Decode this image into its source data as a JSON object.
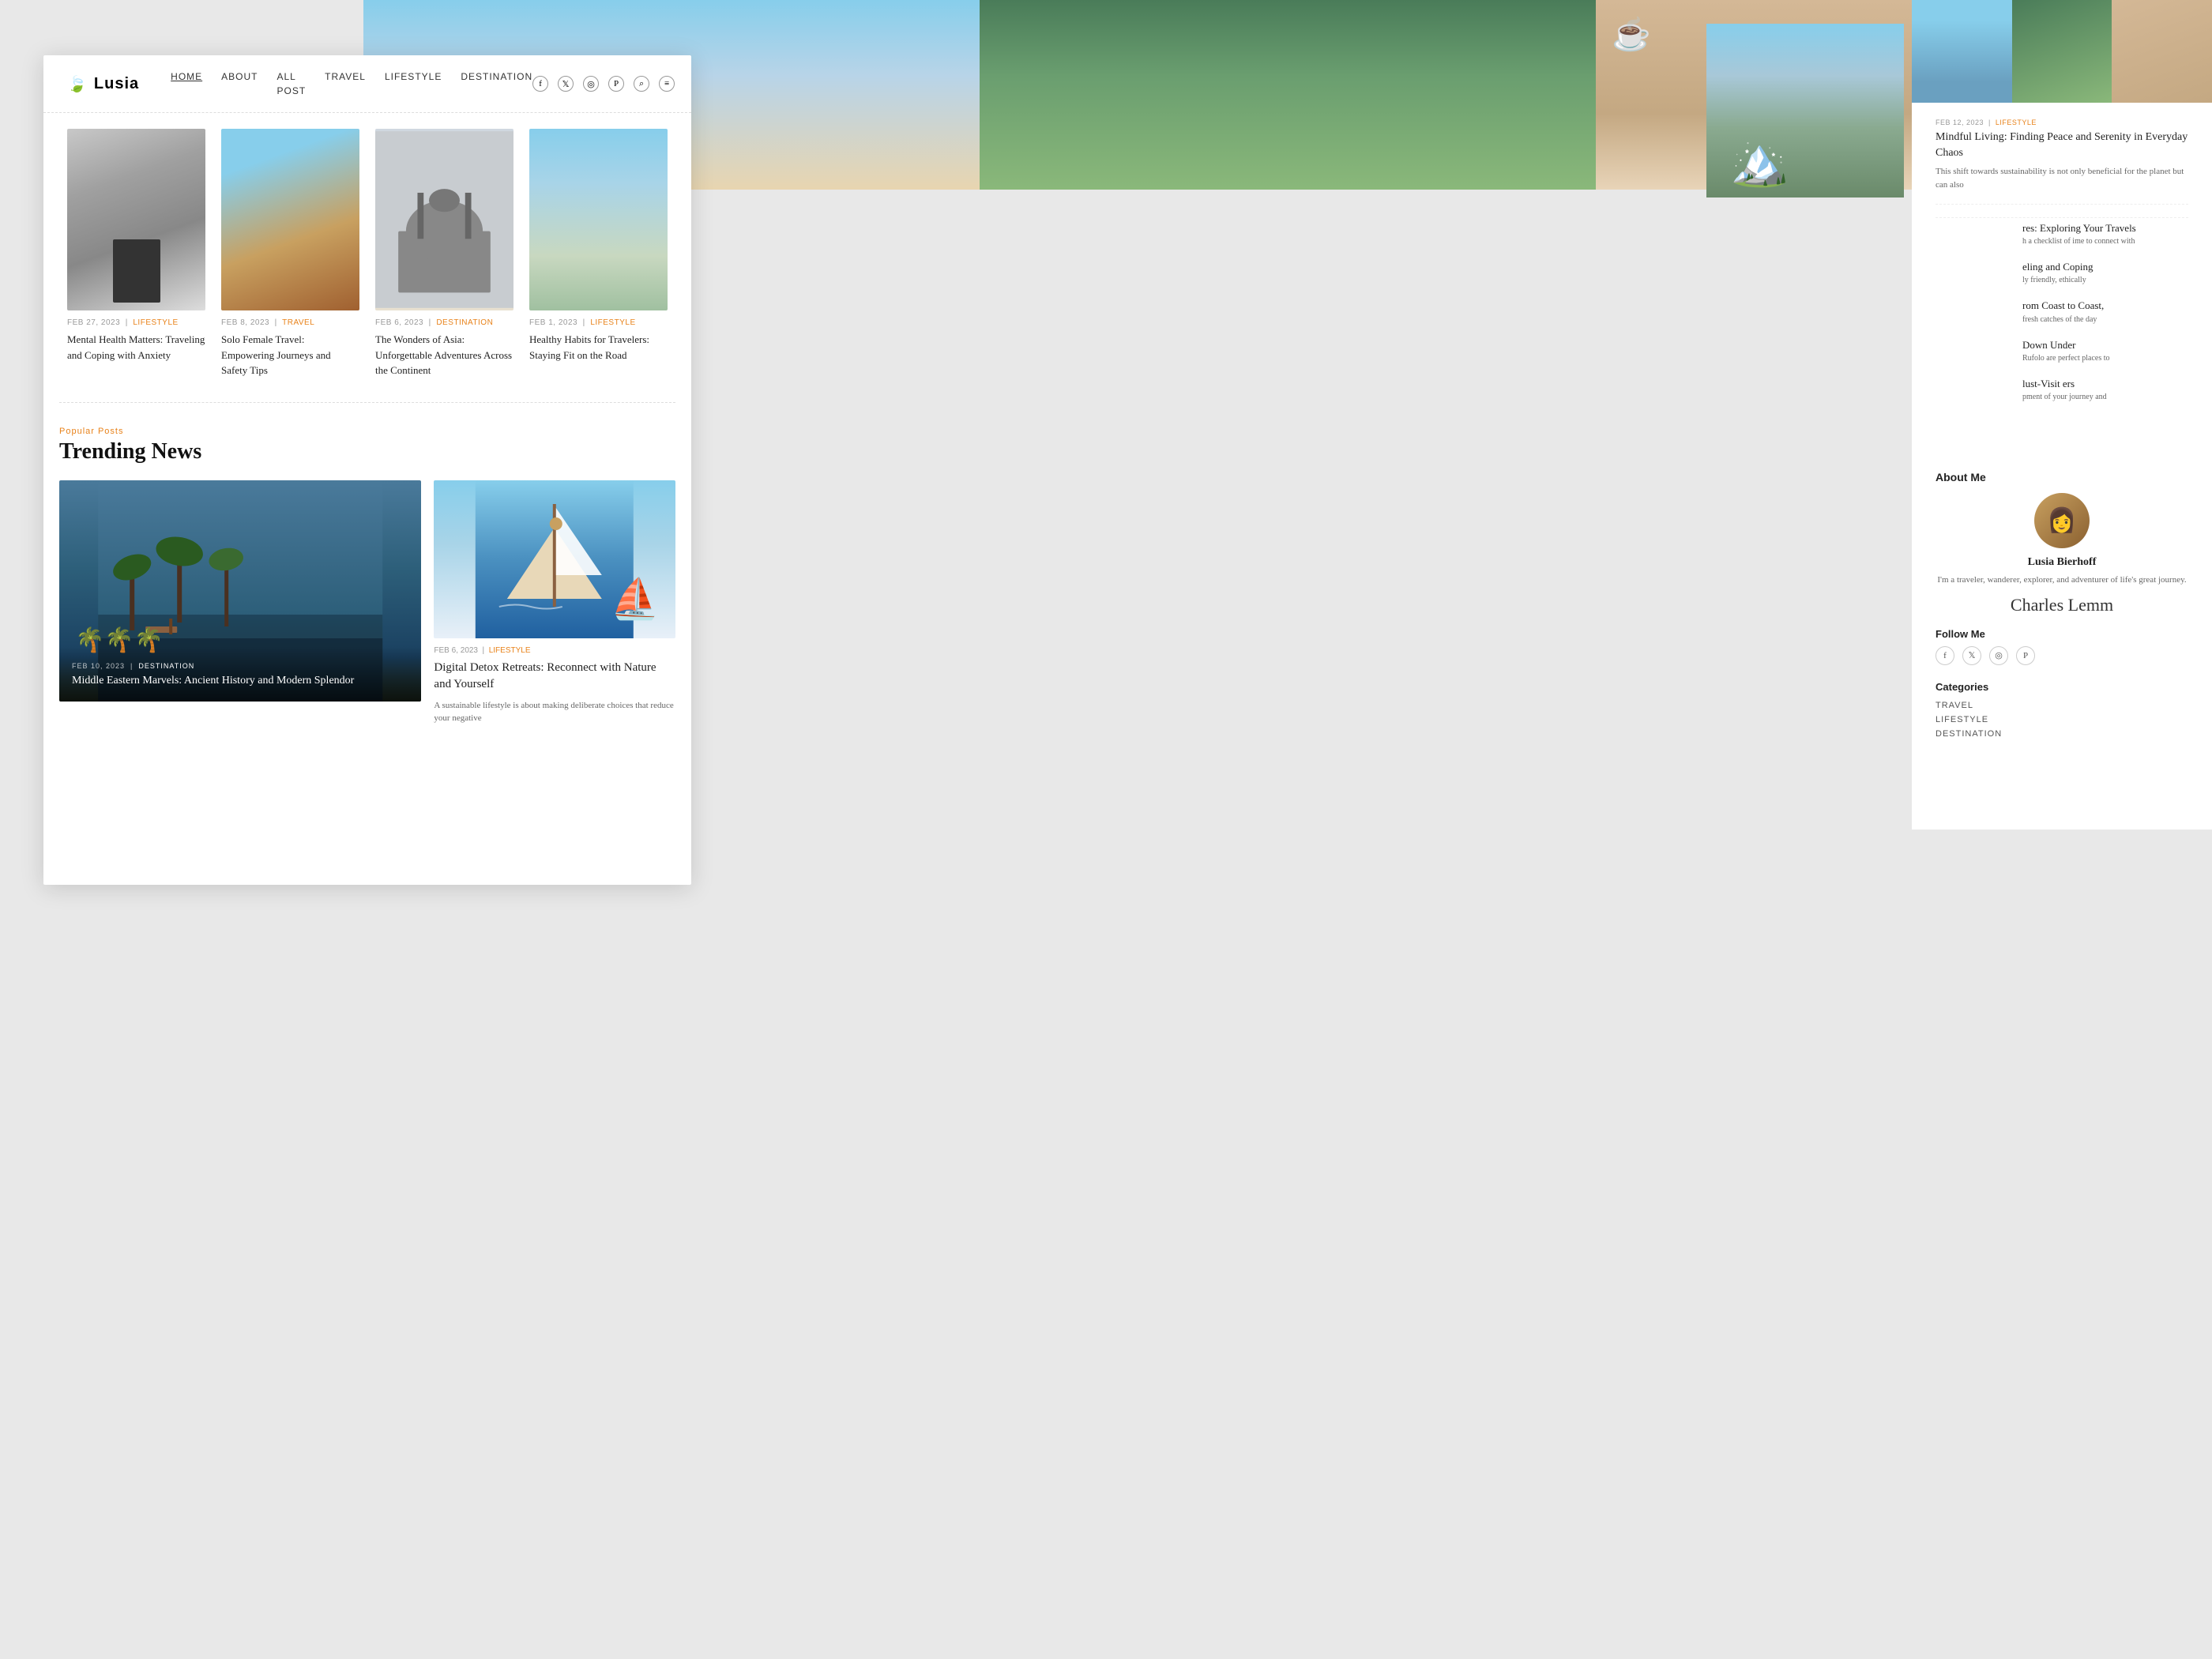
{
  "logo": {
    "name": "Lusia",
    "icon": "🍃"
  },
  "nav": {
    "links": [
      {
        "label": "HOME",
        "active": true
      },
      {
        "label": "ABOUT",
        "active": false
      },
      {
        "label": "ALL POST",
        "active": false
      },
      {
        "label": "TRAVEL",
        "active": false
      },
      {
        "label": "LIFESTYLE",
        "active": false
      },
      {
        "label": "DESTINATION",
        "active": false
      }
    ]
  },
  "articles": [
    {
      "date": "FEB 27, 2023",
      "category": "LIFESTYLE",
      "title": "Mental Health Matters: Traveling and Coping with Anxiety"
    },
    {
      "date": "FEB 8, 2023",
      "category": "TRAVEL",
      "title": "Solo Female Travel: Empowering Journeys and Safety Tips"
    },
    {
      "date": "FEB 6, 2023",
      "category": "DESTINATION",
      "title": "The Wonders of Asia: Unforgettable Adventures Across the Continent"
    },
    {
      "date": "FEB 1, 2023",
      "category": "LIFESTYLE",
      "title": "Healthy Habits for Travelers: Staying Fit on the Road"
    }
  ],
  "trending": {
    "label": "Popular Posts",
    "title": "Trending News",
    "main": {
      "date": "FEB 10, 2023",
      "category": "DESTINATION",
      "title": "Middle Eastern Marvels: Ancient History and Modern Splendor"
    },
    "secondary": {
      "date": "FEB 6, 2023",
      "category": "LIFESTYLE",
      "title": "Digital Detox Retreats: Reconnect with Nature and Yourself",
      "description": "A sustainable lifestyle is about making deliberate choices that reduce your negative"
    }
  },
  "sidebar": {
    "rp_articles": [
      {
        "date": "FEB 12, 2023",
        "category": "LIFESTYLE",
        "title": "Mindful Living: Finding Peace and Serenity in Everyday Chaos",
        "description": "This shift towards sustainability is not only beneficial for the planet but can also"
      }
    ],
    "bg_articles": [
      {
        "title": "res: Exploring Your Travels",
        "description": "h a checklist of ime to connect with"
      },
      {
        "title": "eling and Coping",
        "description": "ly friendly, ethically"
      },
      {
        "title": "rom Coast to Coast,",
        "description": "fresh catches of the day"
      },
      {
        "title": "Down Under",
        "description": "Rufolo are perfect places to"
      },
      {
        "title": "lust-Visit ers",
        "description": "pment of your journey and"
      }
    ],
    "about": {
      "title": "About Me",
      "name": "Lusia Bierhoff",
      "description": "I'm a traveler, wanderer, explorer, and adventurer of life's great journey.",
      "signature": "Charles Lemm"
    },
    "follow": {
      "title": "Follow Me"
    },
    "categories": {
      "title": "Categories",
      "items": [
        "TRAVEL",
        "LIFESTYLE",
        "DESTINATION"
      ]
    }
  }
}
